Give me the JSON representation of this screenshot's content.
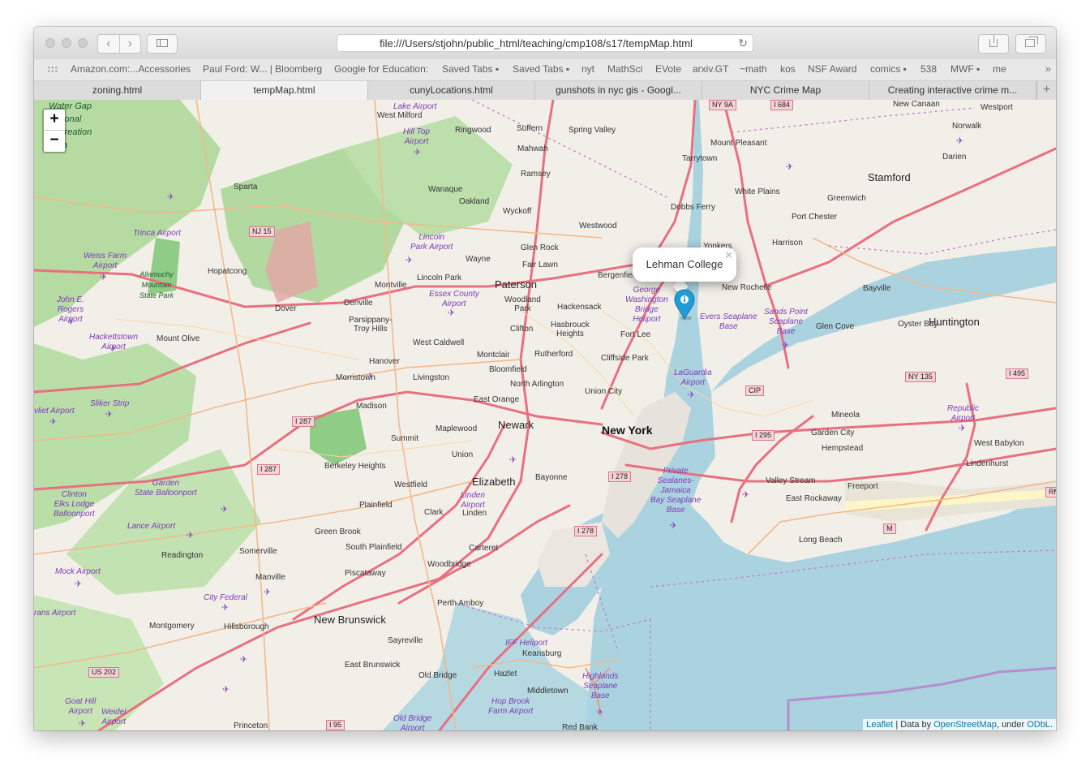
{
  "browser": {
    "url": "file:///Users/stjohn/public_html/teaching/cmp108/s17/tempMap.html",
    "bookmarks": [
      "Amazon.com:...Accessories",
      "Paul Ford: W... | Bloomberg",
      "Google for Education:",
      "Saved Tabs ▪",
      "Saved Tabs ▪",
      "nyt",
      "MathSci",
      "EVote",
      "arxiv.GT",
      "~math",
      "kos",
      "NSF Award",
      "comics ▪",
      "538",
      "MWF ▪",
      "me"
    ],
    "tabs": [
      {
        "label": "zoning.html",
        "active": false
      },
      {
        "label": "tempMap.html",
        "active": true
      },
      {
        "label": "cunyLocations.html",
        "active": false
      },
      {
        "label": "gunshots in nyc gis - Googl...",
        "active": false
      },
      {
        "label": "NYC Crime Map",
        "active": false
      },
      {
        "label": "Creating interactive crime m...",
        "active": false
      }
    ],
    "new_tab": "+",
    "back_icon": "‹",
    "forward_icon": "›",
    "reload_icon": "↻",
    "overflow_icon": "»"
  },
  "map": {
    "zoom_in": "+",
    "zoom_out": "−",
    "popup_text": "Lehman College",
    "popup_close": "×",
    "attribution": {
      "leaflet": "Leaflet",
      "sep": " | Data by ",
      "osm": "OpenStreetMap",
      "under": ", under ",
      "odbl": "ODbL",
      "end": "."
    },
    "colors": {
      "land": "#f2efe9",
      "forest": "#a9d49a",
      "water": "#aad3df",
      "motorway": "#e8707f",
      "primary": "#fcd6a4",
      "marker": "#1e9dd8"
    },
    "places": {
      "new_york": "New York",
      "newark": "Newark",
      "paterson": "Paterson",
      "elizabeth": "Elizabeth",
      "new_brunswick": "New Brunswick",
      "stamford": "Stamford",
      "huntington": "Huntington",
      "new_rochelle": "New Rochelle",
      "white_plains": "White Plains",
      "yonkers": "Yonkers",
      "hackensack": "Hackensack",
      "union_city": "Union City",
      "bayonne": "Bayonne",
      "sparta": "Sparta",
      "montclair": "Montclair",
      "morristown": "Morristown",
      "mineola": "Mineola",
      "freeport": "Freeport",
      "long_beach": "Long Beach",
      "perth_amboy": "Perth Amboy",
      "woodbridge": "Woodbridge",
      "plainfield": "Plainfield",
      "somerville": "Somerville",
      "princeton": "Princeton",
      "oyster_bay": "Oyster Bay",
      "glen_cove": "Glen Cove",
      "port_chester": "Port Chester",
      "greenwich": "Greenwich",
      "norwalk": "Norwalk",
      "darien": "Darien",
      "westport": "Westport",
      "new_canaan": "New Canaan",
      "bayville": "Bayville",
      "hempstead": "Hempstead",
      "garden_city": "Garden City",
      "valley_stream": "Valley Stream",
      "lindenhurst": "Lindenhurst",
      "west_babylon": "West Babylon",
      "east_rockaway": "East Rockaway",
      "sayreville": "Sayreville",
      "keansburg": "Keansburg",
      "hazlet": "Hazlet",
      "middletown": "Middletown",
      "red_bank": "Red Bank",
      "old_bridge": "Old Bridge",
      "east_brunswick": "East Brunswick",
      "piscataway": "Piscataway",
      "manville": "Manville",
      "hillsborough": "Hillsborough",
      "montgomery": "Montgomery",
      "readington": "Readington",
      "green_brook": "Green Brook",
      "south_plainfield": "South Plainfield",
      "carteret": "Carteret",
      "clark": "Clark",
      "linden": "Linden",
      "westfield": "Westfield",
      "union": "Union",
      "summit": "Summit",
      "maplewood": "Maplewood",
      "east_orange": "East Orange",
      "livingston": "Livingston",
      "madison": "Madison",
      "berkeley_heights": "Berkeley Heights",
      "hanover": "Hanover",
      "west_caldwell": "West Caldwell",
      "denville": "Denville",
      "dover": "Dover",
      "parsippany": "Parsippany-\nTroy Hills",
      "mount_olive": "Mount Olive",
      "hopatcong": "Hopatcong",
      "montville": "Montville",
      "lincoln_park": "Lincoln Park",
      "wayne": "Wayne",
      "wanaque": "Wanaque",
      "oakland": "Oakland",
      "wyckoff": "Wyckoff",
      "ramsey": "Ramsey",
      "mahwah": "Mahwah",
      "suffern": "Suffern",
      "ringwood": "Ringwood",
      "west_milford": "West Milford",
      "spring_valley": "Spring Valley",
      "glen_rock": "Glen Rock",
      "fair_lawn": "Fair Lawn",
      "westwood": "Westwood",
      "bergenfield": "Bergenfield",
      "dobbs_ferry": "Dobbs Ferry",
      "tarrytown": "Tarrytown",
      "mount_pleasant": "Mount Pleasant",
      "harrison": "Harrison",
      "woodland_park": "Woodland\nPark",
      "clifton": "Clifton",
      "hasbrouck_heights": "Hasbrouck\nHeights",
      "fort_lee": "Fort Lee",
      "rutherford": "Rutherford",
      "cliffside_park": "Cliffside Park",
      "bloomfield": "Bloomfield",
      "north_arlington": "North Arlington"
    },
    "features": {
      "george_washington_bridge_heliport": "George\nWashington\nBridge\nHeliport",
      "evers_seaplane_base": "Evers Seaplane\nBase",
      "laguardia_airport": "LaGuardia\nAirport",
      "sands_point_seaplane_base": "Sands Point\nSeaplane\nBase",
      "republic_airport": "Republic\nAirport",
      "private_sealanes": "Private\nSealanes-\nJamaica\nBay Seaplane\nBase",
      "linden_airport": "Linden\nAirport",
      "iff_heliport": "IFF Heliport",
      "highlands_seaplane_base": "Highlands\nSeaplane\nBase",
      "hop_brook_farm_airport": "Hop Brook\nFarm Airport",
      "old_bridge_airport": "Old Bridge\nAirport",
      "city_federal": "City Federal",
      "mock_airport": "Mock Airport",
      "lance_airport": "Lance Airport",
      "garden_state_balloonport": "Garden\nState Balloonport",
      "clinton_elks_lodge_balloonport": "Clinton\nElks Lodge\nBalloonport",
      "sliker_strip": "Sliker Strip",
      "hackettstown_airport": "Hackettstown\nAirport",
      "john_e_rogers_airport": "John E.\nRogers\nAirport",
      "weiss_farm_airport": "Weiss Farm\nAirport",
      "trinca_airport": "Trinca Airport",
      "allamuchy": "Allamuchy\nMountain\nState Park",
      "lincoln_park_airport": "Lincoln\nPark Airport",
      "essex_county_airport": "Essex County\nAirport",
      "lake_airport": "Lake Airport",
      "hill_top_airport": "Hill Top\nAirport",
      "goat_hill_airport": "Goat Hill\nAirport",
      "weidel_airport": "Weidel\nAirport",
      "delaware_water_gap": "Water Gap\nNational\nRecreation\nArea",
      "rans_airport": "rans Airport",
      "vliet_airport": "vliet Airport"
    },
    "shields": {
      "nj15": "NJ 15",
      "ny9a": "NY 9A",
      "i684": "I 684",
      "i287a": "I 287",
      "i287b": "I 287",
      "i278a": "I 278",
      "i278b": "I 278",
      "i295": "I 295",
      "cip": "CIP",
      "ny135": "NY 135",
      "i495": "I 495",
      "us202": "US 202",
      "i95": "I 95",
      "m": "M",
      "rm": "RM"
    }
  }
}
